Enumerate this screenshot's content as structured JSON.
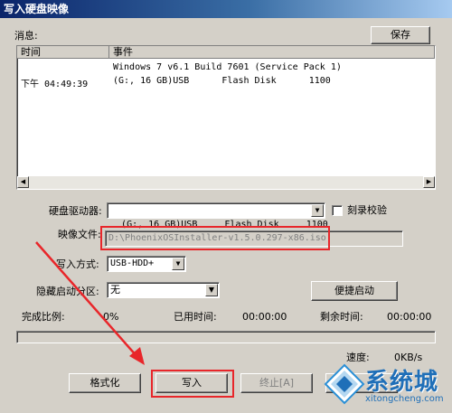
{
  "window": {
    "title": "写入硬盘映像"
  },
  "log": {
    "label": "消息:",
    "save_label": "保存",
    "columns": [
      "时间",
      "事件"
    ],
    "rows": [
      {
        "time": "",
        "event": "Windows 7 v6.1 Build 7601 (Service Pack 1)"
      },
      {
        "time": "下午 04:49:39",
        "event": "(G:, 16 GB)USB      Flash Disk      1100"
      }
    ]
  },
  "form": {
    "drive_label": "硬盘驱动器:",
    "drive_value": "(G:, 16 GB)USB     Flash Disk     1100",
    "verify_label": "刻录校验",
    "image_label": "映像文件:",
    "image_value": "D:\\PhoenixOSInstaller-v1.5.0.297-x86.iso",
    "write_method_label": "写入方式:",
    "write_method_value": "USB-HDD+",
    "hidden_boot_label": "隐藏启动分区:",
    "hidden_boot_value": "无",
    "easy_boot_label": "便捷启动"
  },
  "progress": {
    "done_label": "完成比例:",
    "done_value": "0%",
    "elapsed_label": "已用时间:",
    "elapsed_value": "00:00:00",
    "remaining_label": "剩余时间:",
    "remaining_value": "00:00:00",
    "speed_label": "速度:",
    "speed_value": "0KB/s",
    "fraction": 0
  },
  "buttons": {
    "format": "格式化",
    "write": "写入",
    "abort": "终止[A]"
  },
  "watermark": {
    "brand": "系统城",
    "url": "xitongcheng.com"
  },
  "colors": {
    "accent_red": "#e8262a",
    "title_blue": "#0a246a"
  }
}
